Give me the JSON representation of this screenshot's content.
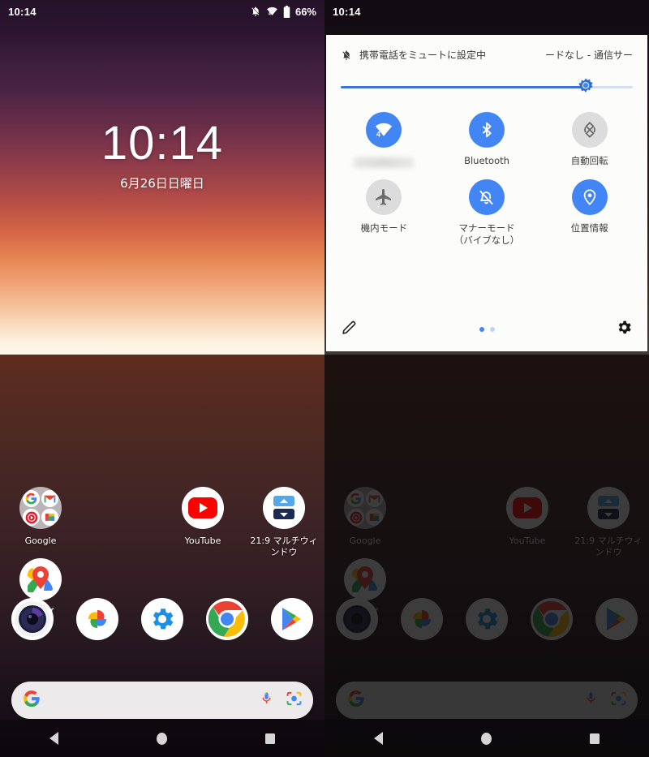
{
  "left_panel": {
    "status_bar": {
      "time": "10:14",
      "battery_percent": "66%",
      "icons": [
        "mute-bell-icon",
        "wifi-4-icon",
        "battery-icon"
      ]
    },
    "clock_widget": {
      "time": "10:14",
      "date": "6月26日日曜日"
    },
    "apps": [
      {
        "label": "Google",
        "icon": "google-folder-icon"
      },
      {
        "label": "",
        "icon": "empty-slot"
      },
      {
        "label": "YouTube",
        "icon": "youtube-icon"
      },
      {
        "label": "マップ",
        "icon": "google-maps-icon"
      },
      {
        "label": "21:9 マルチウィンドウ",
        "icon": "multiwindow-icon"
      }
    ],
    "dock": [
      {
        "label": "Camera",
        "icon": "camera-icon"
      },
      {
        "label": "Photos",
        "icon": "google-photos-icon"
      },
      {
        "label": "Settings",
        "icon": "settings-gear-icon"
      },
      {
        "label": "Chrome",
        "icon": "chrome-icon"
      },
      {
        "label": "Play Store",
        "icon": "play-store-icon"
      }
    ],
    "search_bar": {
      "placeholder": "",
      "logo": "google-g-icon",
      "mic": "microphone-icon",
      "lens": "google-lens-icon"
    },
    "nav_bar": {
      "back": "back-icon",
      "home": "home-icon",
      "recents": "recents-icon"
    }
  },
  "right_panel": {
    "status_bar": {
      "time": "10:14"
    },
    "quick_settings": {
      "header_left": "携帯電話をミュートに設定中",
      "header_left_icon": "mute-bell-icon",
      "header_right": "ードなし - 通信サー",
      "brightness": {
        "value": 84,
        "thumb_icon": "brightness-sun-icon"
      },
      "tiles": [
        {
          "label": "",
          "icon": "wifi-4-icon",
          "state": "on",
          "label_blurred": true
        },
        {
          "label": "Bluetooth",
          "icon": "bluetooth-icon",
          "state": "on",
          "highlighted": true
        },
        {
          "label": "自動回転",
          "icon": "auto-rotate-icon",
          "state": "off"
        },
        {
          "label": "機内モード",
          "icon": "airplane-icon",
          "state": "off"
        },
        {
          "label": "マナーモード\n（バイブなし）",
          "icon": "mute-bell-icon",
          "state": "on"
        },
        {
          "label": "位置情報",
          "icon": "location-pin-icon",
          "state": "on"
        }
      ],
      "footer": {
        "edit_icon": "pencil-edit-icon",
        "settings_icon": "gear-icon",
        "pages": 2,
        "active_page": 1
      }
    }
  },
  "colors": {
    "accent_blue": "#4285f4",
    "highlight_red": "#fb2816",
    "tile_off_gray": "#dcdcdc",
    "panel_bg": "#fcfcfa"
  }
}
